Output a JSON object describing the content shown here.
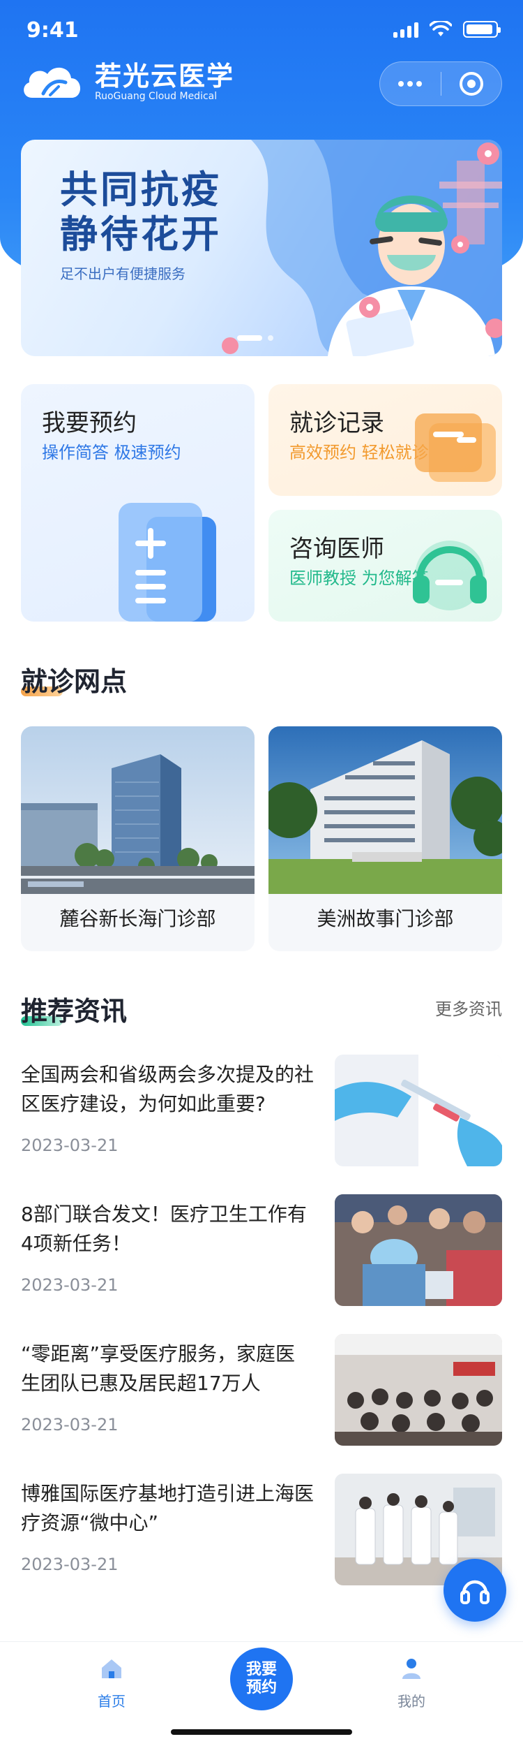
{
  "status_bar": {
    "time": "9:41"
  },
  "brand": {
    "name": "若光云医学",
    "subtitle": "RuoGuang Cloud Medical"
  },
  "banner": {
    "title_line1": "共同抗疫",
    "title_line2": "静待花开",
    "subtitle": "足不出户有便捷服务"
  },
  "services": {
    "book": {
      "title": "我要预约",
      "subtitle": "操作简答 极速预约"
    },
    "record": {
      "title": "就诊记录",
      "subtitle": "高效预约 轻松就诊"
    },
    "consult": {
      "title": "咨询医师",
      "subtitle": "医师教授 为您解答"
    }
  },
  "clinics": {
    "title": "就诊网点",
    "items": [
      {
        "name": "麓谷新长海门诊部"
      },
      {
        "name": "美洲故事门诊部"
      }
    ]
  },
  "news": {
    "title": "推荐资讯",
    "more": "更多资讯",
    "items": [
      {
        "title": "全国两会和省级两会多次提及的社区医疗建设，为何如此重要?",
        "date": "2023-03-21"
      },
      {
        "title": "8部门联合发文！医疗卫生工作有4项新任务！",
        "date": "2023-03-21"
      },
      {
        "title": "“零距离”享受医疗服务，家庭医生团队已惠及居民超17万人",
        "date": "2023-03-21"
      },
      {
        "title": "博雅国际医疗基地打造引进上海医疗资源“微中心”",
        "date": "2023-03-21"
      }
    ]
  },
  "tabbar": {
    "home": "首页",
    "center_line1": "我要",
    "center_line2": "预约",
    "mine": "我的"
  },
  "colors": {
    "primary": "#1f74f2",
    "orange": "#f29a2e",
    "green": "#22b98b"
  }
}
